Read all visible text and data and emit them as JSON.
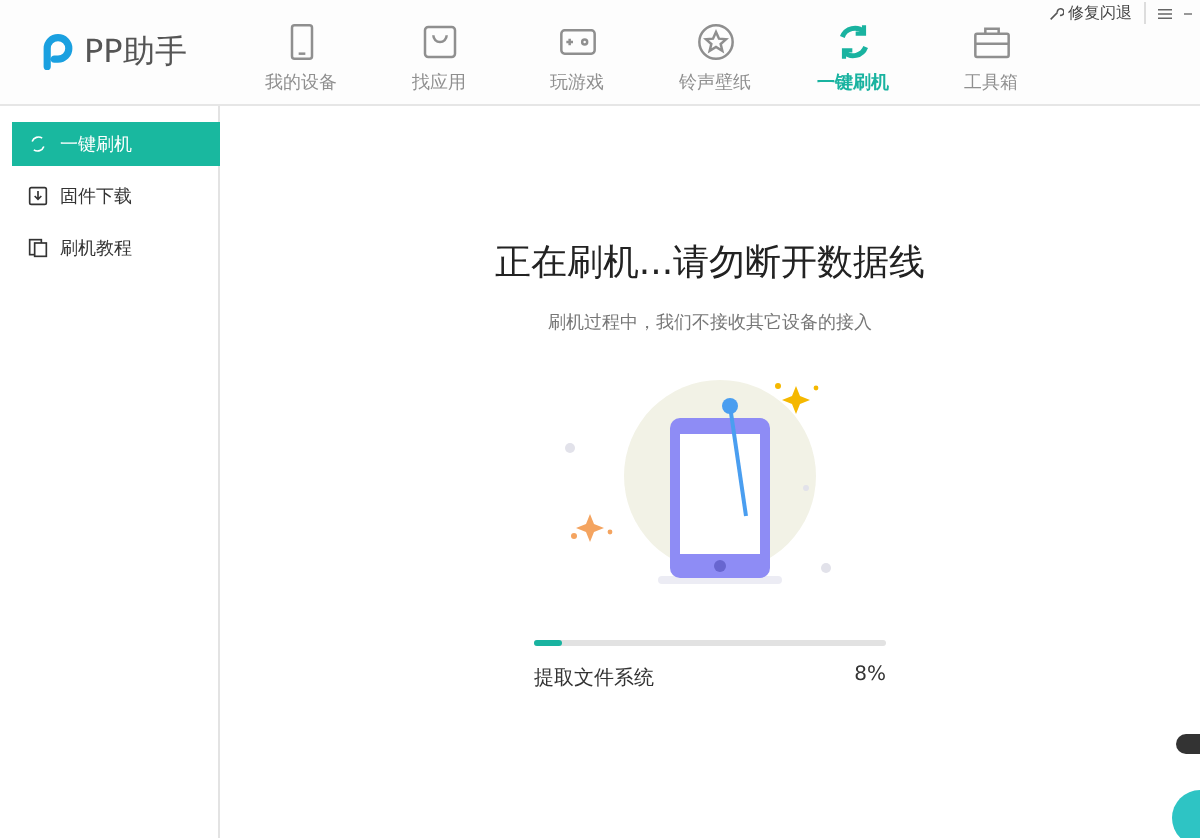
{
  "app": {
    "logo_text": "PP助手"
  },
  "top_links": [
    {
      "label": "修复闪退"
    }
  ],
  "nav_tabs": [
    {
      "label": "我的设备",
      "kind": "phone",
      "selected": false
    },
    {
      "label": "找应用",
      "kind": "bag",
      "selected": false
    },
    {
      "label": "玩游戏",
      "kind": "game",
      "selected": false
    },
    {
      "label": "铃声壁纸",
      "kind": "star",
      "selected": false
    },
    {
      "label": "一键刷机",
      "kind": "refresh",
      "selected": true
    },
    {
      "label": "工具箱",
      "kind": "toolbox",
      "selected": false
    }
  ],
  "sidebar": {
    "items": [
      {
        "label": "一键刷机",
        "kind": "refresh",
        "selected": true
      },
      {
        "label": "固件下载",
        "kind": "download",
        "selected": false
      },
      {
        "label": "刷机教程",
        "kind": "doc",
        "selected": false
      }
    ]
  },
  "main": {
    "title": "正在刷机...请勿断开数据线",
    "subtitle": "刷机过程中，我们不接收其它设备的接入",
    "progress": {
      "level": 0.08,
      "step": "提取文件系统",
      "percent": "8%"
    }
  }
}
